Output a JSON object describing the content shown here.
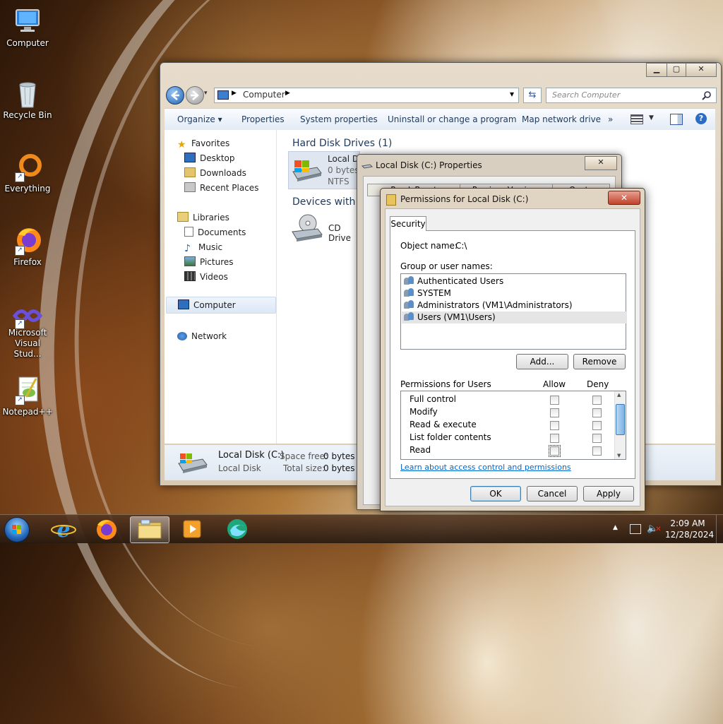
{
  "desktop": {
    "icons": [
      {
        "label": "Computer"
      },
      {
        "label": "Recycle Bin"
      },
      {
        "label": "Everything"
      },
      {
        "label": "Firefox"
      },
      {
        "label": "Microsoft Visual Stud..."
      },
      {
        "label": "Notepad++"
      }
    ]
  },
  "explorer": {
    "caption": {
      "minimize": "▁",
      "maximize": "▢",
      "close": "✕"
    },
    "address": {
      "path": "Computer",
      "dropdown_arrow": "▾",
      "refresh_icon": "refresh-icon"
    },
    "search_placeholder": "Search Computer",
    "toolbar": {
      "organize": "Organize ▾",
      "properties": "Properties",
      "system_properties": "System properties",
      "uninstall": "Uninstall or change a program",
      "map_network": "Map network drive",
      "more": "»"
    },
    "nav": {
      "favorites": "Favorites",
      "desktop": "Desktop",
      "downloads": "Downloads",
      "recent_places": "Recent Places",
      "libraries": "Libraries",
      "documents": "Documents",
      "music": "Music",
      "pictures": "Pictures",
      "videos": "Videos",
      "computer": "Computer",
      "network": "Network"
    },
    "content": {
      "hdd_group": "Hard Disk Drives (1)",
      "drive_name": "Local D",
      "drive_size": "0 bytes",
      "drive_fs": "NTFS",
      "devices_group": "Devices with r",
      "cd_drive": "CD Drive"
    },
    "details": {
      "name": "Local Disk (C:)",
      "type": "Local Disk",
      "space_free_label": "Space free:",
      "space_free_value": "0 bytes",
      "total_size_label": "Total size:",
      "total_size_value": "0 bytes"
    }
  },
  "properties_window": {
    "title": "Local Disk (C:) Properties",
    "close": "✕",
    "tabs": [
      "ReadyBoost",
      "Previous Versions",
      "Quota"
    ]
  },
  "permissions_dialog": {
    "title": "Permissions for Local Disk (C:)",
    "close": "✕",
    "tab": "Security",
    "object_name_label": "Object name:",
    "object_name_value": "C:\\",
    "group_label": "Group or user names:",
    "users": [
      "Authenticated Users",
      "SYSTEM",
      "Administrators (VM1\\Administrators)",
      "Users (VM1\\Users)"
    ],
    "add_button": "Add...",
    "remove_button": "Remove",
    "permissions_label": "Permissions for Users",
    "allow_label": "Allow",
    "deny_label": "Deny",
    "permissions": [
      {
        "name": "Full control",
        "allow": false,
        "deny": false
      },
      {
        "name": "Modify",
        "allow": false,
        "deny": false
      },
      {
        "name": "Read & execute",
        "allow": false,
        "deny": false
      },
      {
        "name": "List folder contents",
        "allow": false,
        "deny": false
      },
      {
        "name": "Read",
        "allow": false,
        "deny": false
      }
    ],
    "learn_link": "Learn about access control and permissions",
    "ok": "OK",
    "cancel": "Cancel",
    "apply": "Apply"
  },
  "taskbar": {
    "clock_time": "2:09 AM",
    "clock_date": "12/28/2024",
    "tray_up_arrow": "▲"
  },
  "colors": {
    "accent": "#1e395b",
    "link": "#0066cc",
    "close_red": "#c0432b"
  }
}
